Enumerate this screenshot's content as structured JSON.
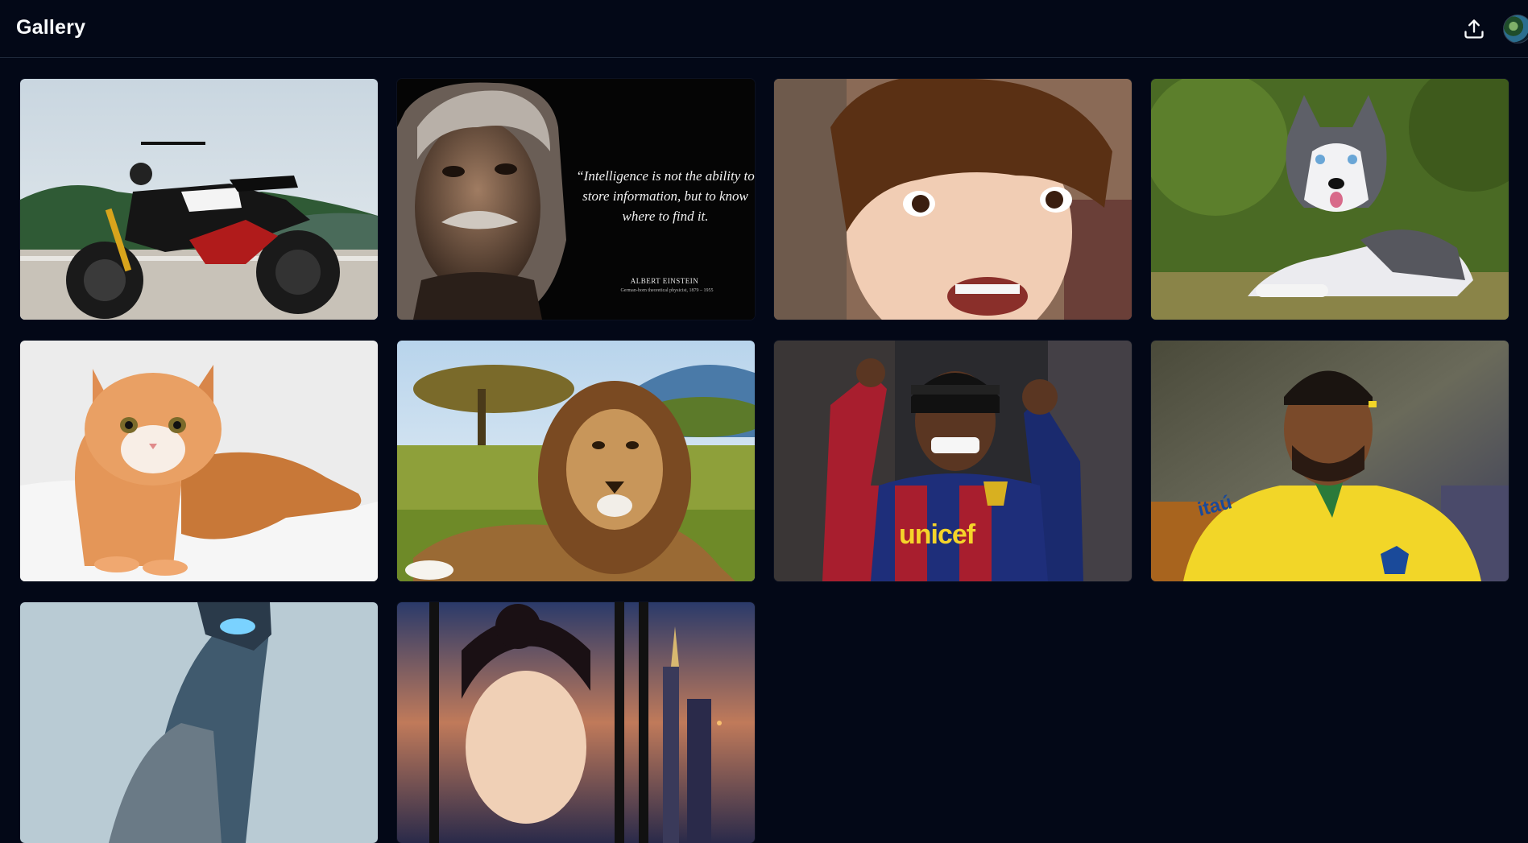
{
  "app": {
    "title": "Gallery"
  },
  "header": {
    "upload_icon": "upload-icon",
    "avatar_icon": "user-avatar"
  },
  "gallery": {
    "images": [
      {
        "subject": "motorcycle"
      },
      {
        "subject": "einstein-quote",
        "quote": "“Intelligence is not the ability to store information, but to know where to find it.",
        "author": "ALBERT EINSTEIN",
        "author_sub": "German-born theoretical physicist, 1879 – 1955"
      },
      {
        "subject": "child"
      },
      {
        "subject": "husky"
      },
      {
        "subject": "orange-cat"
      },
      {
        "subject": "lion"
      },
      {
        "subject": "footballer-barcelona",
        "jersey_text": "unicef"
      },
      {
        "subject": "footballer-brazil",
        "jersey_text": "itaú"
      },
      {
        "subject": "android-robot"
      },
      {
        "subject": "woman-city-night"
      }
    ]
  },
  "colors": {
    "background": "#030817",
    "border": "#1e293b",
    "text": "#f8fafc"
  }
}
